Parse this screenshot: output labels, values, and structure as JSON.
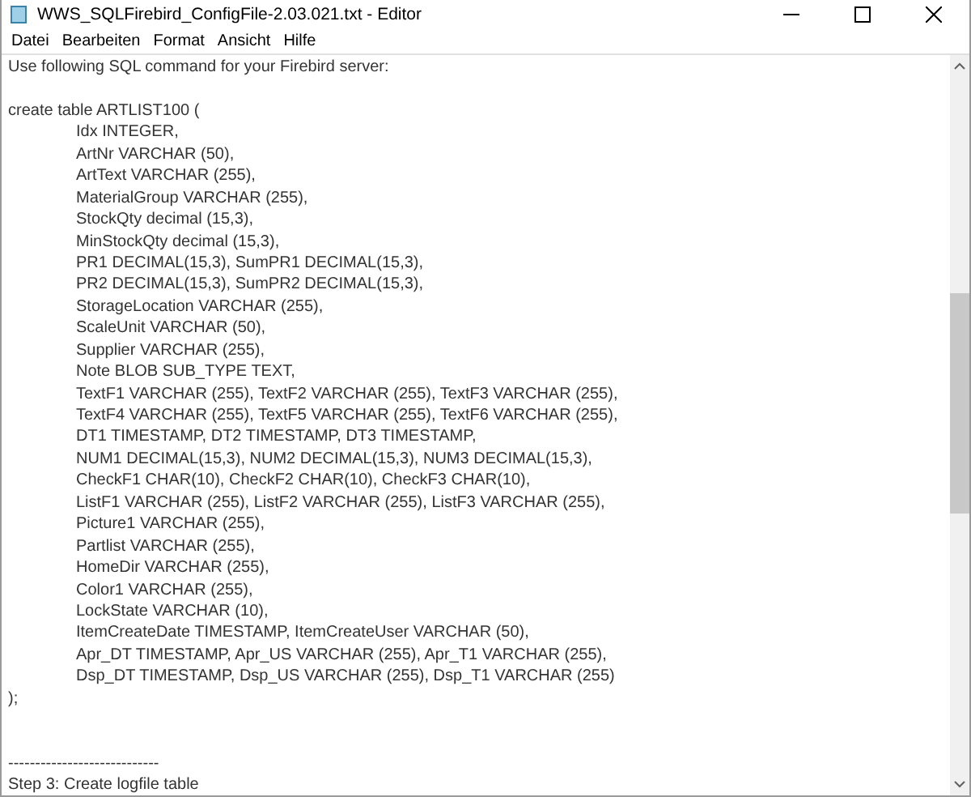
{
  "window": {
    "title": "WWS_SQLFirebird_ConfigFile-2.03.021.txt - Editor"
  },
  "menu": [
    "Datei",
    "Bearbeiten",
    "Format",
    "Ansicht",
    "Hilfe"
  ],
  "lines": [
    {
      "kind": "text",
      "text": "Use following SQL command for your Firebird server:"
    },
    {
      "kind": "blank"
    },
    {
      "kind": "text",
      "text": "create table ARTLIST100 ("
    },
    {
      "kind": "indented",
      "text": "Idx INTEGER,"
    },
    {
      "kind": "indented",
      "text": "ArtNr VARCHAR (50),"
    },
    {
      "kind": "indented",
      "text": "ArtText VARCHAR (255),"
    },
    {
      "kind": "indented",
      "text": "MaterialGroup VARCHAR (255),"
    },
    {
      "kind": "indented",
      "text": "StockQty decimal (15,3),"
    },
    {
      "kind": "indented",
      "text": "MinStockQty decimal (15,3),"
    },
    {
      "kind": "indented",
      "text": "PR1 DECIMAL(15,3), SumPR1 DECIMAL(15,3),"
    },
    {
      "kind": "indented",
      "text": "PR2 DECIMAL(15,3), SumPR2 DECIMAL(15,3),"
    },
    {
      "kind": "indented",
      "text": "StorageLocation VARCHAR (255),"
    },
    {
      "kind": "indented",
      "text": "ScaleUnit VARCHAR (50),"
    },
    {
      "kind": "indented",
      "text": "Supplier VARCHAR (255),"
    },
    {
      "kind": "indented",
      "text": "Note BLOB SUB_TYPE TEXT,"
    },
    {
      "kind": "indented",
      "text": "TextF1 VARCHAR (255), TextF2 VARCHAR (255), TextF3 VARCHAR (255),"
    },
    {
      "kind": "indented",
      "text": "TextF4 VARCHAR (255), TextF5 VARCHAR (255), TextF6 VARCHAR (255),"
    },
    {
      "kind": "indented",
      "text": "DT1 TIMESTAMP, DT2 TIMESTAMP, DT3 TIMESTAMP,"
    },
    {
      "kind": "indented",
      "text": "NUM1 DECIMAL(15,3), NUM2 DECIMAL(15,3), NUM3 DECIMAL(15,3),"
    },
    {
      "kind": "indented",
      "text": "CheckF1 CHAR(10), CheckF2 CHAR(10), CheckF3 CHAR(10),"
    },
    {
      "kind": "indented",
      "text": "ListF1 VARCHAR (255), ListF2 VARCHAR (255), ListF3 VARCHAR (255),"
    },
    {
      "kind": "indented",
      "text": "Picture1 VARCHAR (255),"
    },
    {
      "kind": "indented",
      "text": "Partlist VARCHAR (255),"
    },
    {
      "kind": "indented",
      "text": "HomeDir VARCHAR (255),"
    },
    {
      "kind": "indented",
      "text": "Color1 VARCHAR (255),"
    },
    {
      "kind": "indented",
      "text": "LockState VARCHAR (10),"
    },
    {
      "kind": "indented",
      "text": "ItemCreateDate TIMESTAMP, ItemCreateUser VARCHAR (50),"
    },
    {
      "kind": "indented",
      "text": "Apr_DT TIMESTAMP, Apr_US VARCHAR (255), Apr_T1 VARCHAR (255),"
    },
    {
      "kind": "indented",
      "text": "Dsp_DT TIMESTAMP, Dsp_US VARCHAR (255), Dsp_T1 VARCHAR (255)"
    },
    {
      "kind": "text",
      "text": ");"
    },
    {
      "kind": "blank"
    },
    {
      "kind": "blank"
    },
    {
      "kind": "text",
      "text": "----------------------------"
    },
    {
      "kind": "text",
      "text": "Step 3: Create logfile table"
    }
  ]
}
